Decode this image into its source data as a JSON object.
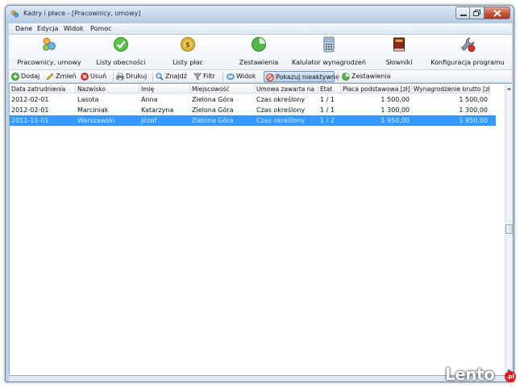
{
  "window": {
    "title": "Kadry i płace - [Pracownicy, umowy]",
    "close_glyph": "✕"
  },
  "menu": [
    "Dane",
    "Edycja",
    "Widok",
    "Pomoc"
  ],
  "ribbon": [
    {
      "label": "Pracownicy, umowy",
      "icon": "users-icon"
    },
    {
      "label": "Listy obecności",
      "icon": "checkmark-icon"
    },
    {
      "label": "Listy płac",
      "icon": "coin-icon"
    },
    {
      "label": "Zestawienia",
      "icon": "pie-chart-icon"
    },
    {
      "label": "Kalulator wynagrodzeń",
      "icon": "calculator-icon"
    },
    {
      "label": "Słowniki",
      "icon": "book-icon"
    },
    {
      "label": "Konfiguracja programu",
      "icon": "wrench-icon"
    }
  ],
  "toolbar": [
    {
      "label": "Dodaj",
      "icon": "add-icon"
    },
    {
      "label": "Zmień",
      "icon": "edit-icon"
    },
    {
      "label": "Usuń",
      "icon": "delete-icon"
    },
    {
      "label": "Drukuj",
      "icon": "printer-icon"
    },
    {
      "label": "Znajdź",
      "icon": "search-icon"
    },
    {
      "label": "Filtr",
      "icon": "filter-icon"
    },
    {
      "label": "Widok",
      "icon": "view-icon"
    },
    {
      "label": "Pokazuj nieaktywne",
      "icon": "inactive-icon",
      "active": true
    },
    {
      "label": "Zestawienia",
      "icon": "report-icon"
    }
  ],
  "table": {
    "columns": [
      "Data zatrudnienia",
      "Nazwisko",
      "Imię",
      "Miejscowość",
      "Umowa zawarta na",
      "Etat",
      "Płaca podstawowa [zł]",
      "Wynagrodzenie brutto [zł]"
    ],
    "rows": [
      [
        "2012-02-01",
        "Lasota",
        "Anna",
        "Zielona Góra",
        "Czas określony",
        "1 / 1",
        "1 500,00",
        "1 500,00"
      ],
      [
        "2012-02-01",
        "Marciniak",
        "Katarzyna",
        "Zielona Góra",
        "Czas określony",
        "1 / 1",
        "1 300,00",
        "1 300,00"
      ],
      [
        "2011-11-01",
        "Warszawski",
        "Józef",
        "Zielona Góra",
        "Czas określony",
        "1 / 2",
        "1 950,00",
        "1 950,00"
      ]
    ],
    "selected_row": 2
  },
  "watermark": {
    "text": "Lento",
    "badge": ".pl"
  },
  "colors": {
    "selection": "#3399ff",
    "title_bar": "#c4d6ea",
    "close_button": "#c8543c"
  }
}
